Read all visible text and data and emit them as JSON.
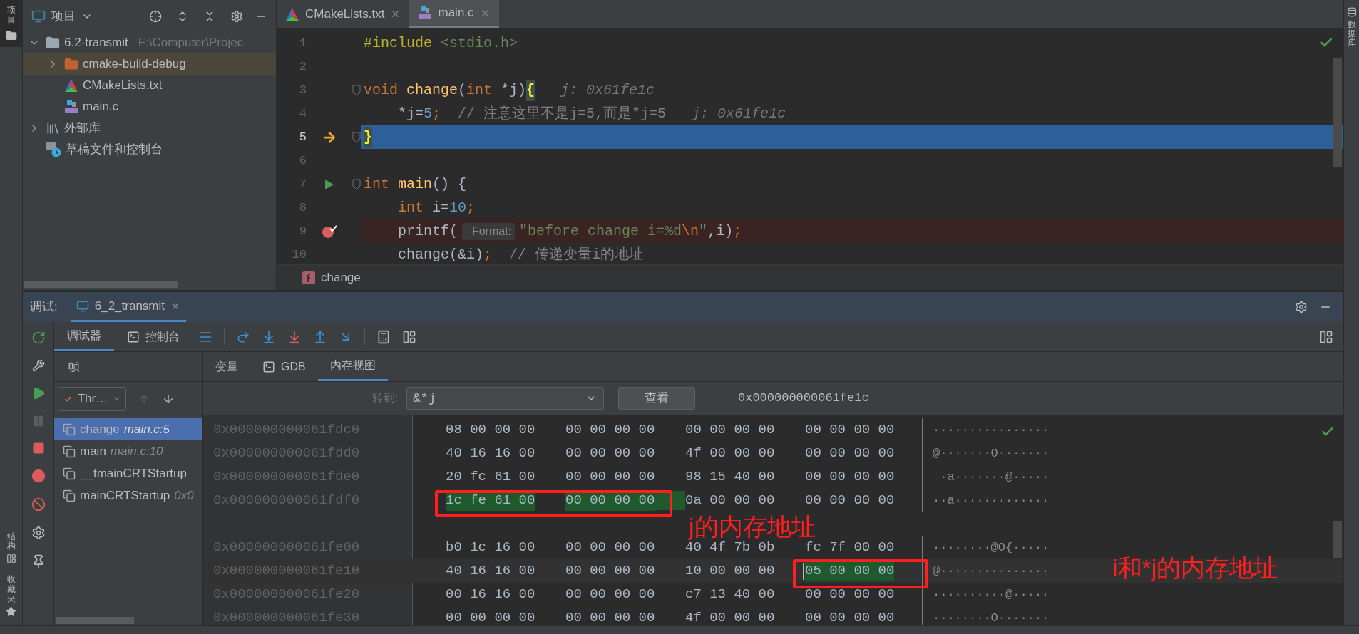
{
  "left_strip": {
    "top": [
      {
        "label": "项目",
        "selected": true
      }
    ],
    "bottom": [
      {
        "label": "结构"
      },
      {
        "label": "收藏夹"
      }
    ]
  },
  "project": {
    "title": "项目",
    "tree": [
      {
        "name": "6.2-transmit",
        "path": "F:\\Computer\\Projec",
        "kind": "folder",
        "expanded": true,
        "selected": false,
        "children": [
          {
            "name": "cmake-build-debug",
            "kind": "build-folder",
            "expanded": false,
            "selected": true
          },
          {
            "name": "CMakeLists.txt",
            "kind": "cmake",
            "selected": false
          },
          {
            "name": "main.c",
            "kind": "c-file",
            "selected": false
          }
        ]
      },
      {
        "name": "外部库",
        "kind": "library",
        "expanded": false,
        "selected": false
      },
      {
        "name": "草稿文件和控制台",
        "kind": "scratch",
        "selected": false
      }
    ]
  },
  "editor": {
    "tabs": [
      {
        "label": "CMakeLists.txt",
        "kind": "cmake",
        "selected": false
      },
      {
        "label": "main.c",
        "kind": "c-file",
        "selected": true
      }
    ],
    "lines": [
      {
        "number": "1",
        "kind": "plain",
        "tokens": [
          {
            "text": "#include",
            "kind": "directive"
          },
          {
            "text": " <stdio.h>",
            "kind": "string"
          }
        ]
      },
      {
        "number": "2",
        "kind": "plain"
      },
      {
        "number": "3",
        "kind": "plain",
        "fold": true,
        "tokens": [
          {
            "text": "void",
            "kind": "keyword"
          },
          {
            "text": " change",
            "kind": "function"
          },
          {
            "text": "(",
            "kind": "plain"
          },
          {
            "text": "int",
            "kind": "keyword"
          },
          {
            "text": " *j)",
            "kind": "plain"
          },
          {
            "text": "{",
            "kind": "match"
          },
          {
            "text": "j: 0x61fe1c",
            "kind": "hint"
          }
        ]
      },
      {
        "number": "4",
        "kind": "plain",
        "tokens": [
          {
            "text": "    *j=",
            "kind": "plain"
          },
          {
            "text": "5",
            "kind": "number"
          },
          {
            "text": ";",
            "kind": "keyword"
          },
          {
            "text": "  // 注意这里不是j=5,而是*j=5",
            "kind": "comment"
          },
          {
            "text": "j: 0x61fe1c",
            "kind": "hint"
          }
        ]
      },
      {
        "number": "5",
        "kind": "current",
        "gutter": {
          "kind": "execution-point"
        },
        "fold": true,
        "tokens": [
          {
            "text": "}",
            "kind": "match"
          }
        ]
      },
      {
        "number": "6",
        "kind": "plain"
      },
      {
        "number": "7",
        "kind": "plain",
        "gutter": {
          "kind": "run"
        },
        "fold": true,
        "tokens": [
          {
            "text": "int",
            "kind": "keyword"
          },
          {
            "text": " main",
            "kind": "function"
          },
          {
            "text": "() {",
            "kind": "plain"
          }
        ]
      },
      {
        "number": "8",
        "kind": "plain",
        "tokens": [
          {
            "text": "    int",
            "kind": "keyword"
          },
          {
            "text": " i=",
            "kind": "plain"
          },
          {
            "text": "10",
            "kind": "number"
          },
          {
            "text": ";",
            "kind": "keyword"
          }
        ]
      },
      {
        "number": "9",
        "kind": "breakpoint",
        "gutter": {
          "kind": "breakpoint"
        },
        "tokens": [
          {
            "text": "    printf(",
            "kind": "plain"
          },
          {
            "text": "_Format:",
            "kind": "param"
          },
          {
            "text": "\"before change i=%d",
            "kind": "string"
          },
          {
            "text": "\\n",
            "kind": "escape"
          },
          {
            "text": "\"",
            "kind": "string"
          },
          {
            "text": ",i)",
            "kind": "plain"
          },
          {
            "text": ";",
            "kind": "keyword"
          }
        ]
      },
      {
        "number": "10",
        "kind": "plain",
        "tokens": [
          {
            "text": "    change(&i)",
            "kind": "plain"
          },
          {
            "text": ";",
            "kind": "keyword"
          },
          {
            "text": "  // 传递变量i的地址",
            "kind": "comment"
          }
        ]
      }
    ],
    "breadcrumb": "change"
  },
  "right_strip": {
    "label": "数据库"
  },
  "debug": {
    "label": "调试:",
    "session": "6_2_transmit",
    "tabs": [
      {
        "label": "调试器",
        "selected": true
      },
      {
        "label": "控制台",
        "selected": false
      }
    ],
    "frames_title": "帧",
    "thread": "Thr…",
    "frames": [
      {
        "name": "change",
        "location": "main.c:5",
        "selected": true
      },
      {
        "name": "main",
        "location": "main.c:10",
        "selected": false
      },
      {
        "name": "__tmainCRTStartup",
        "selected": false
      },
      {
        "name": "mainCRTStartup",
        "location": "0x0",
        "selected": false
      }
    ],
    "view_tabs": [
      {
        "label": "变量",
        "selected": false
      },
      {
        "label": "GDB",
        "selected": false
      },
      {
        "label": "内存视图",
        "selected": true
      }
    ],
    "memory": {
      "goto_label": "转到:",
      "goto_value": "&*j",
      "view_button": "查看",
      "address": "0x000000000061fe1c",
      "rows": [
        {
          "address": "0x000000000061fdc0",
          "caret": false,
          "ascii": "················",
          "groups": [
            {
              "hex": "08 00 00 00",
              "highlighted": false
            },
            {
              "hex": "00 00 00 00",
              "highlighted": false
            },
            {
              "hex": "00 00 00 00",
              "highlighted": false
            },
            {
              "hex": "00 00 00 00",
              "highlighted": false
            }
          ]
        },
        {
          "address": "0x000000000061fdd0",
          "caret": false,
          "ascii": "@·······O·······",
          "groups": [
            {
              "hex": "40 16 16 00",
              "highlighted": false
            },
            {
              "hex": "00 00 00 00",
              "highlighted": false
            },
            {
              "hex": "4f 00 00 00",
              "highlighted": false
            },
            {
              "hex": "00 00 00 00",
              "highlighted": false
            }
          ]
        },
        {
          "address": "0x000000000061fde0",
          "caret": false,
          "ascii": " ·a·······@·····",
          "groups": [
            {
              "hex": "20 fc 61 00",
              "highlighted": false
            },
            {
              "hex": "00 00 00 00",
              "highlighted": false
            },
            {
              "hex": "98 15 40 00",
              "highlighted": false
            },
            {
              "hex": "00 00 00 00",
              "highlighted": false
            }
          ]
        },
        {
          "address": "0x000000000061fdf0",
          "caret": false,
          "gap_after": true,
          "ascii": "··a·············",
          "groups": [
            {
              "hex": "1c fe 61 00",
              "highlighted": true
            },
            {
              "hex": "00 00 00 00",
              "highlighted": true
            },
            {
              "hex": "0a 00 00 00",
              "highlighted": false
            },
            {
              "hex": "00 00 00 00",
              "highlighted": false
            }
          ]
        },
        {
          "address": "0x000000000061fe00",
          "caret": false,
          "ascii": "········@O{·····",
          "groups": [
            {
              "hex": "b0 1c 16 00",
              "highlighted": false
            },
            {
              "hex": "00 00 00 00",
              "highlighted": false
            },
            {
              "hex": "40 4f 7b 0b",
              "highlighted": false
            },
            {
              "hex": "fc 7f 00 00",
              "highlighted": false
            }
          ]
        },
        {
          "address": "0x000000000061fe10",
          "caret": true,
          "ascii": "@···············",
          "groups": [
            {
              "hex": "40 16 16 00",
              "highlighted": false
            },
            {
              "hex": "00 00 00 00",
              "highlighted": false
            },
            {
              "hex": "10 00 00 00",
              "highlighted": false
            },
            {
              "hex": "05 00 00 00",
              "highlighted": true
            }
          ]
        },
        {
          "address": "0x000000000061fe20",
          "caret": false,
          "ascii": "··········@·····",
          "groups": [
            {
              "hex": "00 16 16 00",
              "highlighted": false
            },
            {
              "hex": "00 00 00 00",
              "highlighted": false
            },
            {
              "hex": "c7 13 40 00",
              "highlighted": false
            },
            {
              "hex": "00 00 00 00",
              "highlighted": false
            }
          ]
        },
        {
          "address": "0x000000000061fe30",
          "caret": false,
          "ascii": "········O·······",
          "groups": [
            {
              "hex": "00 00 00 00",
              "highlighted": false
            },
            {
              "hex": "00 00 00 00",
              "highlighted": false
            },
            {
              "hex": "4f 00 00 00",
              "highlighted": false
            },
            {
              "hex": "00 00 00 00",
              "highlighted": false
            }
          ]
        }
      ]
    }
  },
  "annotations": [
    {
      "text": "j的内存地址"
    },
    {
      "text": "i和*j的内存地址"
    }
  ]
}
